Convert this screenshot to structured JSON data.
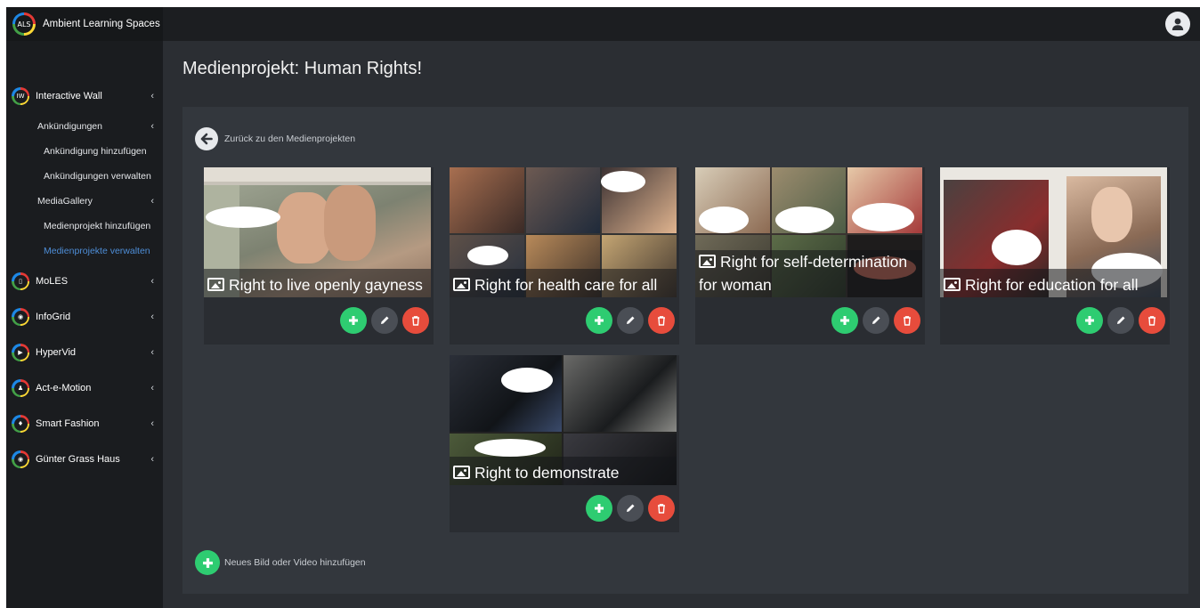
{
  "app": {
    "logo_text": "ALS",
    "title": "Ambient Learning Spaces"
  },
  "sidebar": {
    "items": [
      {
        "label": "Interactive Wall",
        "icon": "IW"
      },
      {
        "label": "MoLES",
        "icon": "mobile-icon"
      },
      {
        "label": "InfoGrid",
        "icon": "map-pin-icon"
      },
      {
        "label": "HyperVid",
        "icon": "play-icon"
      },
      {
        "label": "Act-e-Motion",
        "icon": "person-icon"
      },
      {
        "label": "Smart Fashion",
        "icon": "shirt-icon"
      },
      {
        "label": "Günter Grass Haus",
        "icon": "map-pin-icon"
      }
    ],
    "sub": {
      "ankuendigungen": "Ankündigungen",
      "ankuendigung_hinzufuegen": "Ankündigung hinzufügen",
      "ankuendigungen_verwalten": "Ankündigungen verwalten",
      "mediagallery": "MediaGallery",
      "medienprojekt_hinzufuegen": "Medienprojekt hinzufügen",
      "medienprojekte_verwalten": "Medienprojekte verwalten"
    },
    "chevron": "‹"
  },
  "page": {
    "title": "Medienprojekt: Human Rights!",
    "back_label": "Zurück zu den Medienprojekten",
    "new_media_label": "Neues Bild oder Video hinzufügen"
  },
  "media": [
    {
      "caption": "Right to live openly gayness"
    },
    {
      "caption": "Right for health care for all"
    },
    {
      "caption": "Right for self-determination for woman"
    },
    {
      "caption": "Right for education for all"
    },
    {
      "caption": "Right to demonstrate"
    }
  ],
  "colors": {
    "add": "#2ecc71",
    "edit": "#4a4e55",
    "delete": "#e74c3c",
    "active_link": "#4e8ed8"
  }
}
